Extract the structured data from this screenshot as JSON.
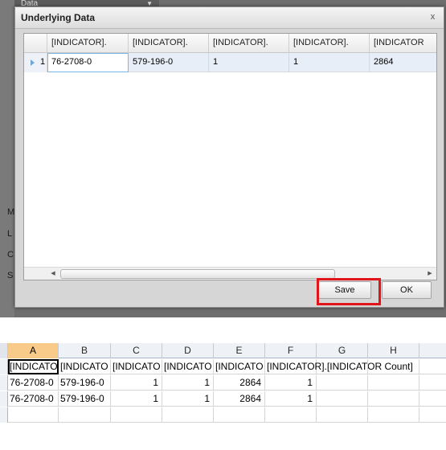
{
  "background_app": {
    "dropdown_label": "Data",
    "side_letters": [
      "M",
      "L",
      "C",
      "S"
    ]
  },
  "dialog": {
    "title": "Underlying Data",
    "close_glyph": "x",
    "columns": [
      "[INDICATOR].",
      "[INDICATOR].",
      "[INDICATOR].",
      "[INDICATOR].",
      "[INDICATOR"
    ],
    "row": {
      "number": "1",
      "cells": [
        "76-2708-0",
        "579-196-0",
        "1",
        "1",
        "2864"
      ]
    },
    "buttons": {
      "save": "Save",
      "ok": "OK"
    },
    "highlight_color": "#e0141a"
  },
  "spreadsheet": {
    "column_letters": [
      "A",
      "B",
      "C",
      "D",
      "E",
      "F",
      "G",
      "H"
    ],
    "active_column": "A",
    "rows": [
      [
        "[INDICATO",
        "[INDICATO",
        "[INDICATO",
        "[INDICATO",
        "[INDICATO",
        "[INDICATOR].[INDICATOR Count]",
        "",
        ""
      ],
      [
        "76-2708-0",
        "579-196-0",
        "1",
        "1",
        "2864",
        "1",
        "",
        ""
      ],
      [
        "76-2708-0",
        "579-196-0",
        "1",
        "1",
        "2864",
        "1",
        "",
        ""
      ]
    ]
  }
}
